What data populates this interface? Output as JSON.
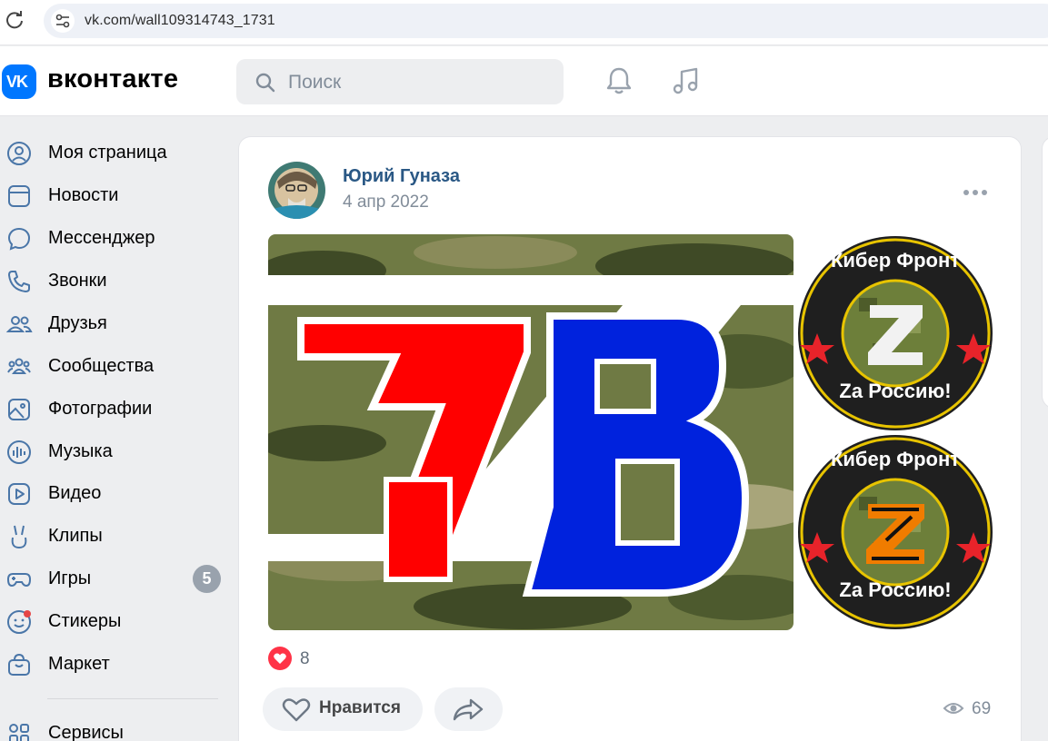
{
  "browser": {
    "url": "vk.com/wall109314743_1731"
  },
  "header": {
    "logo_mark": "VK",
    "wordmark": "вконтакте",
    "search_placeholder": "Поиск",
    "icons": [
      "search-icon",
      "bell-icon",
      "music-icon"
    ]
  },
  "menu": {
    "items": [
      {
        "label": "Моя страница",
        "icon": "user-circle-icon"
      },
      {
        "label": "Новости",
        "icon": "news-icon"
      },
      {
        "label": "Мессенджер",
        "icon": "chat-bubble-icon"
      },
      {
        "label": "Звонки",
        "icon": "phone-icon"
      },
      {
        "label": "Друзья",
        "icon": "friends-icon"
      },
      {
        "label": "Сообщества",
        "icon": "communities-icon"
      },
      {
        "label": "Фотографии",
        "icon": "photo-icon"
      },
      {
        "label": "Музыка",
        "icon": "music-bars-icon"
      },
      {
        "label": "Видео",
        "icon": "video-icon"
      },
      {
        "label": "Клипы",
        "icon": "clips-icon"
      },
      {
        "label": "Игры",
        "icon": "gamepad-icon",
        "badge": "5"
      },
      {
        "label": "Стикеры",
        "icon": "smile-icon"
      },
      {
        "label": "Маркет",
        "icon": "bag-icon"
      },
      {
        "label": "Сервисы",
        "icon": "grid-icon"
      }
    ]
  },
  "post": {
    "author": "Юрий Гуназа",
    "date": "4 апр 2022",
    "image": {
      "logo_letters": "ZAB",
      "sticker_top_caption_top": "Кибер Фронт",
      "sticker_top_caption_bottom": "Za Россию!",
      "sticker_bottom_caption_top": "Кибер Фронт",
      "sticker_bottom_caption_bottom": "Za Россию!"
    },
    "reaction_count": "8",
    "like_label": "Нравится",
    "views": "69"
  },
  "colors": {
    "vk_blue": "#0077ff",
    "link": "#2a5885",
    "like_red": "#ff3347",
    "muted": "#818c99"
  }
}
